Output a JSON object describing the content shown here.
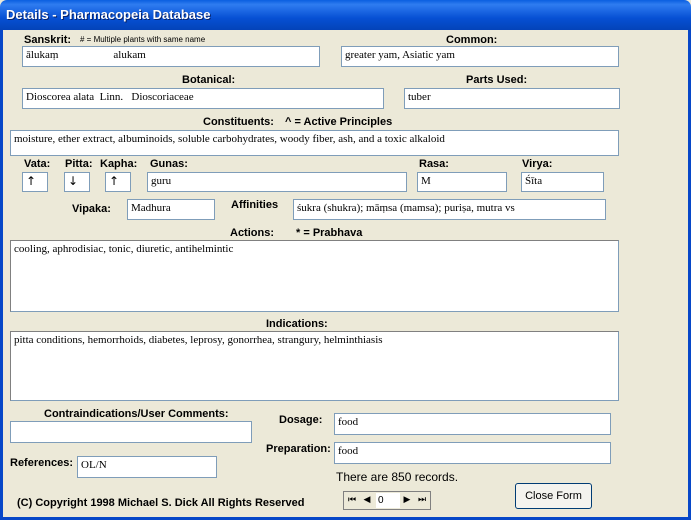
{
  "window": {
    "title": "Details - Pharmacopeia Database"
  },
  "labels": {
    "sanskrit": "Sanskrit:",
    "multiple_note": "# = Multiple plants with same name",
    "common": "Common:",
    "botanical": "Botanical:",
    "parts_used": "Parts Used:",
    "constituents": "Constituents:",
    "active_principles": "^ = Active Principles",
    "vata": "Vata:",
    "pitta": "Pitta:",
    "kapha": "Kapha:",
    "gunas": "Gunas:",
    "rasa": "Rasa:",
    "virya": "Virya:",
    "vipaka": "Vipaka:",
    "affinities": "Affinities",
    "actions": "Actions:",
    "prabhava": "*  =  Prabhava",
    "indications": "Indications:",
    "contraindications": "Contraindications/User Comments:",
    "dosage": "Dosage:",
    "preparation": "Preparation:",
    "references": "References:"
  },
  "fields": {
    "sanskrit": "ālukaṃ                    alukam",
    "common": "greater yam, Asiatic yam",
    "botanical": "Dioscorea alata  Linn.   Dioscoriaceae",
    "parts_used": "tuber",
    "constituents": "moisture, ether extract, albuminoids, soluble carbohydrates, woody fiber, ash, and a toxic alkaloid",
    "vata": "↑",
    "pitta": "↓",
    "kapha": "↑",
    "gunas": "guru",
    "rasa": "M",
    "virya": "Śīta",
    "vipaka": "Madhura",
    "affinities": "śukra (shukra); māṃsa (mamsa); puriṣa, mutra vs",
    "actions": "cooling, aphrodisiac, tonic, diuretic, antihelmintic",
    "indications": "pitta conditions, hemorrhoids, diabetes, leprosy, gonorrhea, strangury, helminthiasis",
    "contraindications": "",
    "dosage": "food",
    "preparation": "food",
    "references": "OL/N"
  },
  "status": {
    "record_count_text": "There are 850 records."
  },
  "footer": {
    "copyright": "(C) Copyright 1998 Michael S. Dick All Rights Reserved"
  },
  "buttons": {
    "close_form": "Close Form"
  },
  "navigator": {
    "record_number": "0"
  }
}
